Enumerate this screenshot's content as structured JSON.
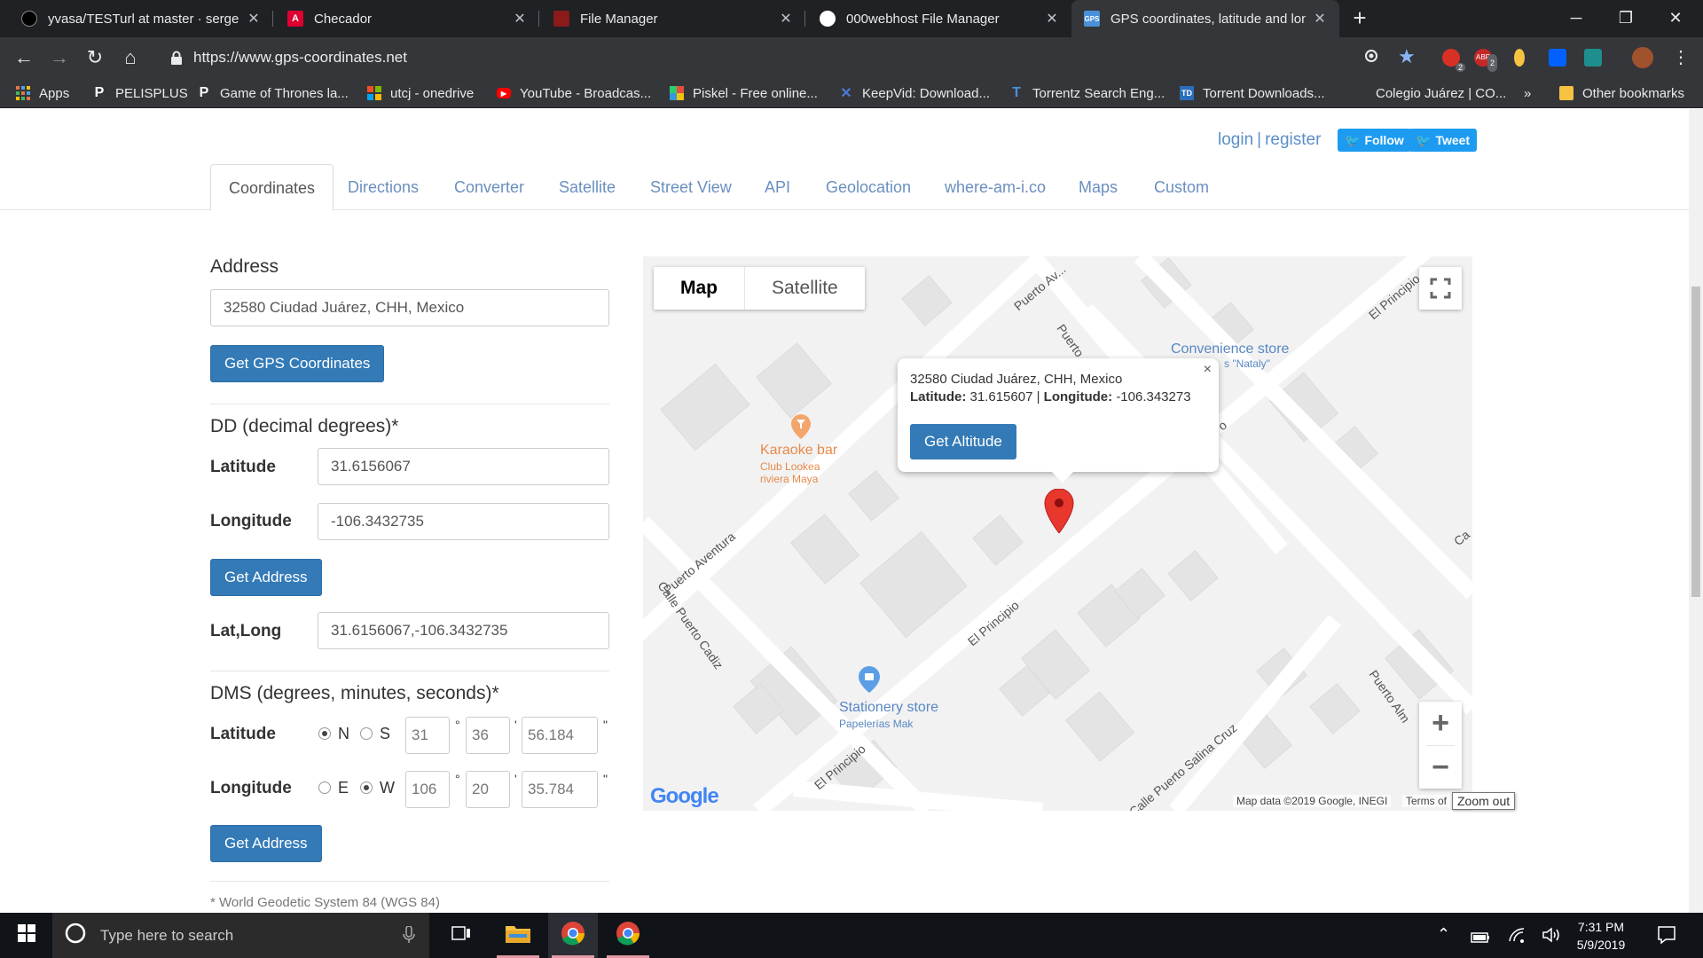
{
  "browser": {
    "tabs": [
      {
        "title": "yvasa/TESTurl at master · sergeii-",
        "icon": "github-icon"
      },
      {
        "title": "Checador",
        "icon": "angular-icon"
      },
      {
        "title": "File Manager",
        "icon": "file-manager-icon"
      },
      {
        "title": "000webhost File Manager",
        "icon": "globe-icon"
      },
      {
        "title": "GPS coordinates, latitude and lon",
        "icon": "gps-icon"
      }
    ],
    "url": "https://www.gps-coordinates.net",
    "ext_badges": [
      "2",
      "2"
    ],
    "bookmarks": [
      {
        "label": "Apps",
        "icon": "apps-grid-icon"
      },
      {
        "label": "PELISPLUS",
        "icon": "p-icon"
      },
      {
        "label": "Game of Thrones la...",
        "icon": "p-icon"
      },
      {
        "label": "utcj - onedrive",
        "icon": "microsoft-icon"
      },
      {
        "label": "YouTube - Broadcas...",
        "icon": "youtube-icon"
      },
      {
        "label": "Piskel - Free online...",
        "icon": "piskel-icon"
      },
      {
        "label": "KeepVid: Download...",
        "icon": "keepvid-icon"
      },
      {
        "label": "Torrentz Search Eng...",
        "icon": "torrentz-icon"
      },
      {
        "label": "Torrent Downloads...",
        "icon": "td-icon"
      },
      {
        "label": "Colegio Juárez | CO...",
        "icon": ""
      }
    ],
    "overflow": "»",
    "other_bookmarks": "Other bookmarks"
  },
  "header": {
    "login": "login",
    "sep": "|",
    "register": "register",
    "follow": "Follow",
    "tweet": "Tweet"
  },
  "nav": [
    "Coordinates",
    "Directions",
    "Converter",
    "Satellite",
    "Street View",
    "API",
    "Geolocation",
    "where-am-i.co",
    "Maps",
    "Custom"
  ],
  "form": {
    "address_heading": "Address",
    "address_value": "32580 Ciudad Juárez, CHH, Mexico",
    "get_gps_button": "Get GPS Coordinates",
    "dd_heading": "DD (decimal degrees)*",
    "latitude_label": "Latitude",
    "latitude_value": "31.6156067",
    "longitude_label": "Longitude",
    "longitude_value": "-106.3432735",
    "get_address_button": "Get Address",
    "latlong_label": "Lat,Long",
    "latlong_value": "31.6156067,-106.3432735",
    "dms_heading": "DMS (degrees, minutes, seconds)*",
    "dms_lat_label": "Latitude",
    "dms_lat": {
      "n": "N",
      "s": "S",
      "deg": "31",
      "min": "36",
      "sec": "56.184"
    },
    "dms_lon_label": "Longitude",
    "dms_lon": {
      "e": "E",
      "w": "W",
      "deg": "106",
      "min": "20",
      "sec": "35.784"
    },
    "deg_sym": "°",
    "min_sym": "'",
    "sec_sym": "\"",
    "get_address_button2": "Get Address",
    "footnote": "* World Geodetic System 84 (WGS 84)"
  },
  "map": {
    "type_map": "Map",
    "type_satellite": "Satellite",
    "popup_address": "32580 Ciudad Juárez, CHH, Mexico",
    "popup_lat_label": "Latitude:",
    "popup_lat": "31.615607",
    "popup_sep": "|",
    "popup_lon_label": "Longitude:",
    "popup_lon": "-106.343273",
    "popup_close": "×",
    "get_altitude": "Get Altitude",
    "zoom_in": "+",
    "zoom_out": "−",
    "zoom_out_tooltip": "Zoom out",
    "attribution": "Map data ©2019 Google, INEGI",
    "terms": "Terms of",
    "google": "Google",
    "pois": {
      "karaoke_title": "Karaoke bar",
      "karaoke_sub1": "Club Lookea",
      "karaoke_sub2": "riviera Maya",
      "convenience_title": "Convenience store",
      "convenience_sub": "s \"Nataly\"",
      "stationery_title": "Stationery store",
      "stationery_sub": "Papelerías Mak"
    },
    "streets": [
      "Puerto Av...",
      "Puerto Alme",
      "El Principio",
      "Puerto Aventura",
      "El Principio",
      "Calle Puerto Cadiz",
      "El Principio",
      "Calle Puerto Salina Cruz",
      "Puerto Alm",
      "Ca",
      "rtu",
      "o"
    ]
  },
  "taskbar": {
    "search_placeholder": "Type here to search",
    "time": "7:31 PM",
    "date": "5/9/2019"
  }
}
